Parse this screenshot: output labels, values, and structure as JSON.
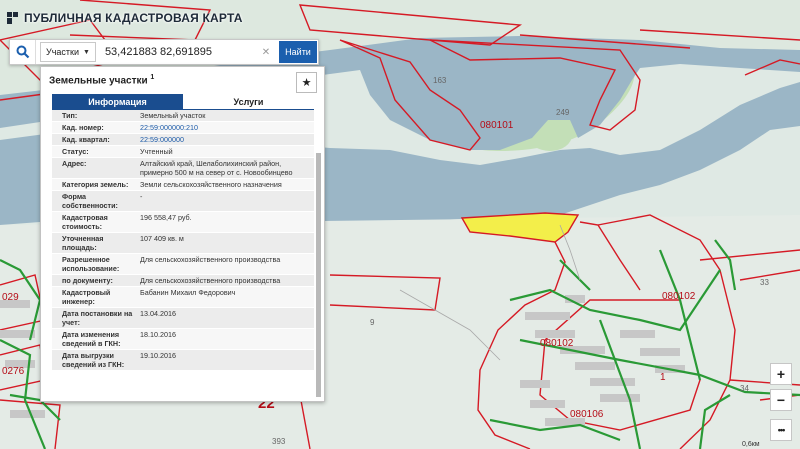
{
  "header": {
    "title": "ПУБЛИЧНАЯ КАДАСТРОВАЯ КАРТА"
  },
  "search": {
    "type_label": "Участки",
    "query": "53,421883 82,691895",
    "find_label": "Найти"
  },
  "panel": {
    "title": "Земельные участки",
    "count": "1",
    "tabs": {
      "info": "Информация",
      "services": "Услуги"
    },
    "rows": [
      {
        "label": "Тип:",
        "value": "Земельный участок"
      },
      {
        "label": "Кад. номер:",
        "value": "22:59:000000:210"
      },
      {
        "label": "Кад. квартал:",
        "value": "22:59:000000"
      },
      {
        "label": "Статус:",
        "value": "Учтенный"
      },
      {
        "label": "Адрес:",
        "value": "Алтайский край, Шелаболихинский район, примерно 500 м на север от с. Новообинцево"
      },
      {
        "label": "Категория земель:",
        "value": "Земли сельскохозяйственного назначения"
      },
      {
        "label": "Форма собственности:",
        "value": "-"
      },
      {
        "label": "Кадастровая стоимость:",
        "value": "196 558,47 руб."
      },
      {
        "label": "Уточненная площадь:",
        "value": "107 409 кв. м"
      },
      {
        "label": "Разрешенное использование:",
        "value": "Для сельскохозяйственного производства"
      },
      {
        "label": "по документу:",
        "value": "Для сельскохозяйственного производства"
      },
      {
        "label": "Кадастровый инженер:",
        "value": "Бабанин Михаил Федорович"
      },
      {
        "label": "Дата постановки на учет:",
        "value": "13.04.2016"
      },
      {
        "label": "Дата изменения сведений в ГКН:",
        "value": "18.10.2016"
      },
      {
        "label": "Дата выгрузки сведений из ГКН:",
        "value": "19.10.2016"
      }
    ]
  },
  "map": {
    "labels": {
      "l163": "163",
      "l249": "249",
      "l080101": "080101",
      "l080102a": "080102",
      "l080102b": "080102",
      "l080106": "080106",
      "l33": "33",
      "l34": "34",
      "l9": "9",
      "l393": "393",
      "l22": "22",
      "l0276": "0276",
      "l029": "029",
      "l1": "1"
    },
    "scale": "0,6км"
  },
  "controls": {
    "zoom_in": "+",
    "zoom_out": "−",
    "more": "•••"
  },
  "colors": {
    "water": "#9bb6c6",
    "land": "#dfe9e4",
    "green_area": "#c3dfb7",
    "parcel_red": "#d51a25",
    "highlight": "#f3ee4a",
    "utilities": "#2a9a36",
    "accent": "#1b5fae"
  }
}
